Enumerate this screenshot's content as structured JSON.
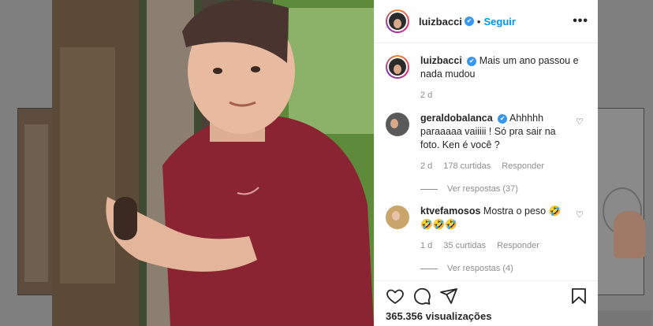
{
  "post": {
    "author": "luizbacci",
    "follow_label": "Seguir",
    "caption": "Mais um ano passou e nada mudou",
    "caption_time": "2 d",
    "views": "365.356 visualizações"
  },
  "comments": [
    {
      "user": "geraldobalanca",
      "verified": true,
      "text": "Ahhhhh paraaaaa vaiiiii ! Só pra sair na foto. Ken é você ?",
      "time": "2 d",
      "likes": "178 curtidas",
      "reply_label": "Responder",
      "view_replies": "Ver respostas (37)"
    },
    {
      "user": "ktvefamosos",
      "verified": false,
      "text": "Mostra o peso 🤣🤣🤣🤣",
      "time": "1 d",
      "likes": "35 curtidas",
      "reply_label": "Responder",
      "view_replies": "Ver respostas (4)"
    }
  ],
  "icons": {
    "like": "heart-icon",
    "comment": "comment-icon",
    "share": "share-icon",
    "save": "bookmark-icon",
    "more": "more-options-icon",
    "verified": "verified-badge-icon"
  },
  "colors": {
    "accent": "#0095f6",
    "verified": "#3897f0",
    "text": "#262626",
    "muted": "#8e8e8e"
  }
}
